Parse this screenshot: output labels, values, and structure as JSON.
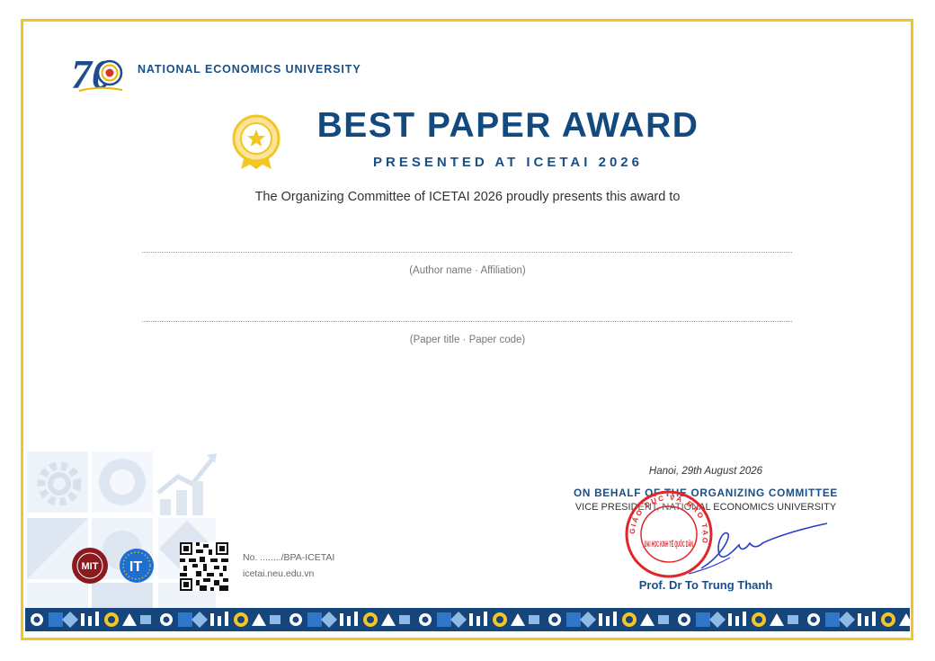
{
  "header": {
    "logo_number": "70",
    "university_name": "NATIONAL ECONOMICS UNIVERSITY"
  },
  "award": {
    "title": "BEST PAPER AWARD",
    "subtitle": "PRESENTED AT ICETAI 2026",
    "presents_text": "The Organizing Committee of ICETAI 2026 proudly presents this award to",
    "author_hint": "(Author name · Affiliation)",
    "paper_hint": "(Paper title · Paper code)"
  },
  "footer": {
    "certificate_no": "No. ......../BPA-ICETAI",
    "website": "icetai.neu.edu.vn"
  },
  "signature": {
    "date": "Hanoi, 29th August 2026",
    "on_behalf": "ON BEHALF OF THE ORGANIZING COMMITTEE",
    "role": "VICE PRESIDENT, NATIONAL ECONOMICS UNIVERSITY",
    "name": "Prof. Dr To Trung Thanh",
    "stamp_text": "ĐẠI HỌC KINH TẾ QUỐC DÂN",
    "stamp_ring_text": "GIÁO DỤC VÀ ĐÀO TẠO"
  },
  "colors": {
    "frame_gold": "#f3c623",
    "navy": "#124a80",
    "stamp_red": "#e0262b",
    "signature_blue": "#2840c8"
  },
  "icons": [
    "university-logo",
    "award-medal-icon",
    "gear-icon",
    "chart-icon",
    "qr-code",
    "partner-logo-mit",
    "partner-logo-it",
    "stamp",
    "signature"
  ]
}
